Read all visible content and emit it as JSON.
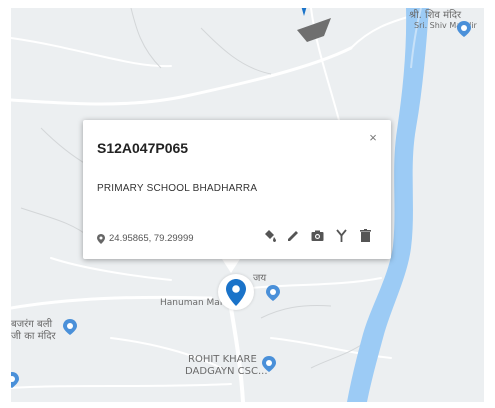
{
  "popup": {
    "title": "S12A047P065",
    "description": "PRIMARY SCHOOL BHADHARRA",
    "coordinates": "24.95865, 79.29999",
    "close_glyph": "×",
    "tools": [
      "paint-bucket-icon",
      "pencil-icon",
      "camera-icon",
      "fork-icon",
      "trash-icon"
    ]
  },
  "map": {
    "labels": {
      "top_right_line1": "श्री. शिव मंदिर",
      "top_right_line2": "Sri. Shiv Mandir",
      "hanuman_line1": "जय",
      "hanuman_line2": "Hanuman Mandira",
      "bajrang_line1": "बजरंग बली",
      "bajrang_line2": "जी का मंदिर",
      "rohit_line1": "ROHIT KHARE",
      "rohit_line2": "DADGAYN CSC..."
    },
    "colors": {
      "river": "#9ccbf5",
      "poi": "#4a90d9",
      "marker": "#1a73c9",
      "polygon": "#6f6f6f"
    }
  }
}
